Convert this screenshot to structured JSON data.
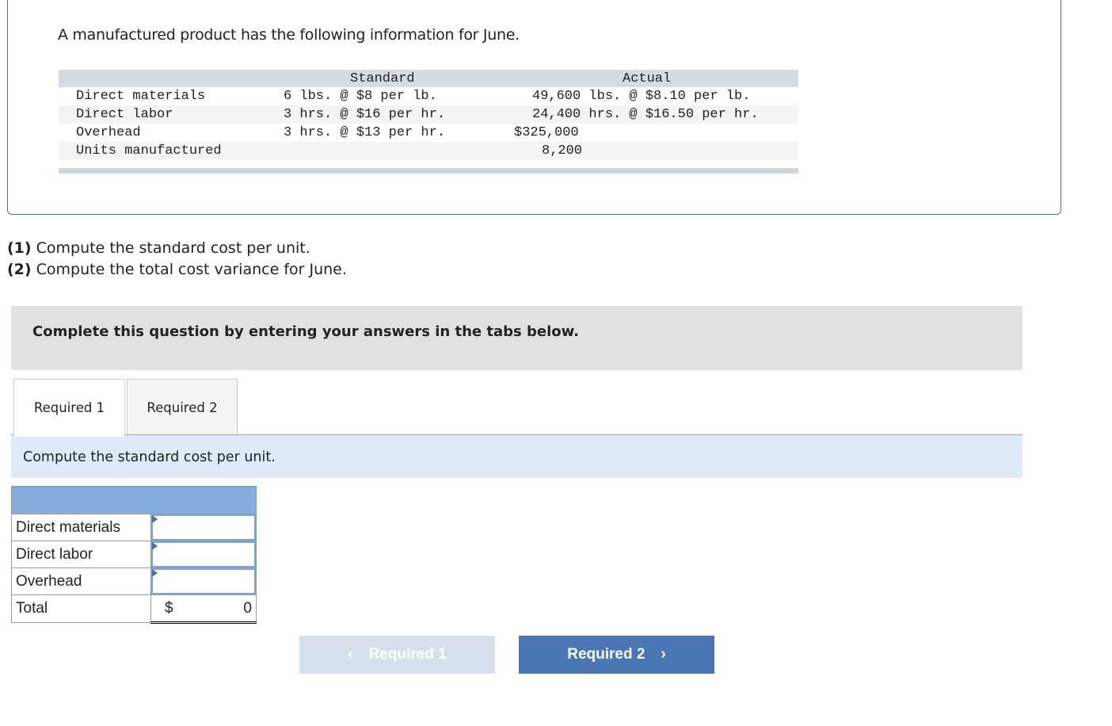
{
  "intro": "A manufactured product has the following information for June.",
  "data_table": {
    "headers": [
      "",
      "Standard",
      "Actual"
    ],
    "rows": [
      {
        "label": "Direct materials",
        "standard": "6 lbs. @ $8 per lb.",
        "actual": "49,600 lbs. @ $8.10 per lb."
      },
      {
        "label": "Direct labor",
        "standard": "3 hrs. @ $16 per hr.",
        "actual": "24,400 hrs. @ $16.50 per hr."
      },
      {
        "label": "Overhead",
        "standard": "3 hrs. @ $13 per hr.",
        "actual": "$325,000"
      },
      {
        "label": "Units manufactured",
        "standard": "",
        "actual": "8,200"
      }
    ]
  },
  "questions": [
    {
      "num": "(1)",
      "text": " Compute the standard cost per unit."
    },
    {
      "num": "(2)",
      "text": " Compute the total cost variance for June."
    }
  ],
  "banner": "Complete this question by entering your answers in the tabs below.",
  "tabs": [
    {
      "label": "Required 1",
      "active": true
    },
    {
      "label": "Required 2",
      "active": false
    }
  ],
  "instruction": "Compute the standard cost per unit.",
  "answer_table": {
    "rows": [
      {
        "label": "Direct materials",
        "value": ""
      },
      {
        "label": "Direct labor",
        "value": ""
      },
      {
        "label": "Overhead",
        "value": ""
      }
    ],
    "total": {
      "label": "Total",
      "currency": "$",
      "value": "0"
    }
  },
  "nav": {
    "prev": "Required 1",
    "next": "Required 2",
    "prev_icon": "chevron-left",
    "next_icon": "chevron-right"
  },
  "colors": {
    "accent": "#4a76b4",
    "header_blue": "#84abdc",
    "disabled": "#d6e0ec"
  }
}
